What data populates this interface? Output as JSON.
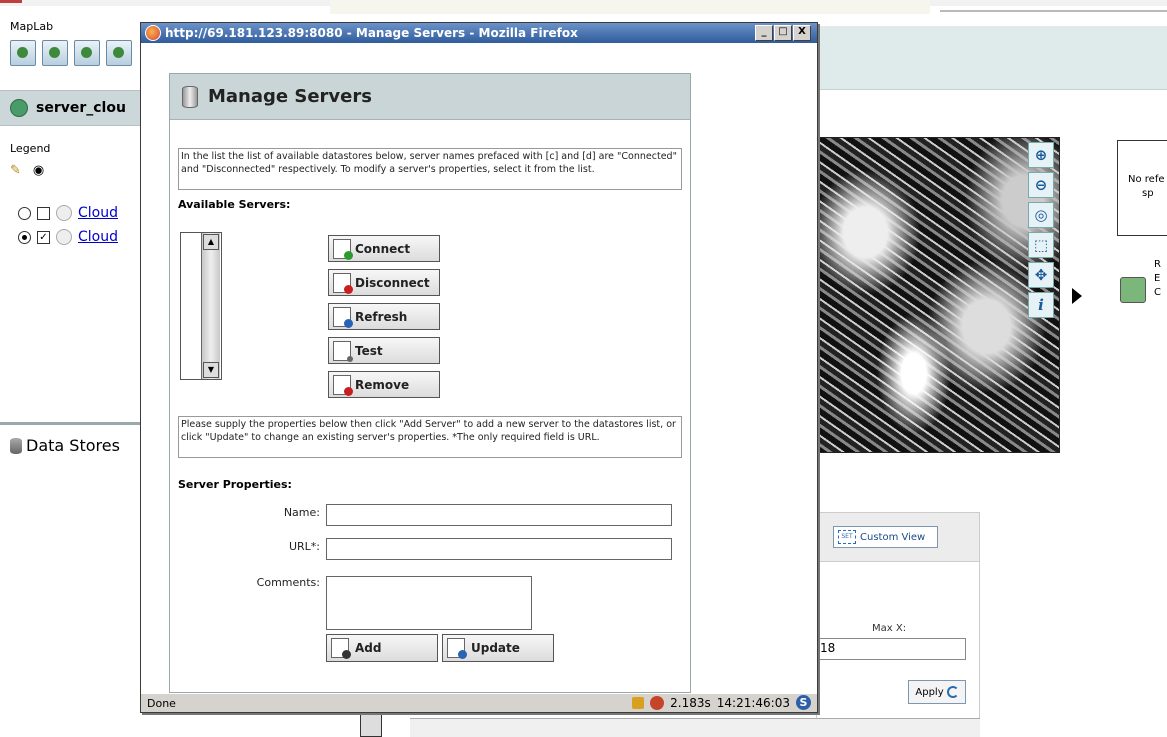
{
  "app": {
    "title": "MapLab"
  },
  "left_panel": {
    "map_name": "server_clou",
    "legend_label": "Legend",
    "legend_icons": [
      "pencil-icon",
      "eye-icon"
    ],
    "layers": [
      {
        "label": "Cloud",
        "radio_selected": false,
        "checked": false
      },
      {
        "label": "Cloud",
        "radio_selected": true,
        "checked": true
      }
    ],
    "datastores_label": "Data Stores"
  },
  "map": {
    "tools": [
      "zoom-in-icon",
      "zoom-out-icon",
      "zoom-full-icon",
      "zoom-box-icon",
      "pan-icon",
      "info-icon"
    ],
    "tool_glyphs": [
      "⊕",
      "⊖",
      "◎",
      "⬚",
      "✥",
      "i"
    ]
  },
  "reference": {
    "box_text_line1": "No refe",
    "box_text_line2": "sp",
    "side_text": [
      "R",
      "E",
      "C"
    ]
  },
  "custom_view": {
    "button_label": "Custom View",
    "icon_text": "SET"
  },
  "extent": {
    "max_x_label": "Max X:",
    "max_x_value": "18",
    "apply_label": "Apply"
  },
  "popup": {
    "window_title": "http://69.181.123.89:8080 - Manage Servers - Mozilla Firefox",
    "window_buttons": [
      "_",
      "□",
      "X"
    ],
    "panel_title": "Manage Servers",
    "list_help": "In the list the list of available datastores below, server names prefaced with [c] and [d] are \"Connected\" and \"Disconnected\" respectively. To modify a server's properties, select it from the list.",
    "available_label": "Available Servers:",
    "actions": [
      {
        "label": "Connect",
        "color": "#2e9a2e"
      },
      {
        "label": "Disconnect",
        "color": "#c82020"
      },
      {
        "label": "Refresh",
        "color": "#2a62b5"
      },
      {
        "label": "Test",
        "color": "#666666"
      },
      {
        "label": "Remove",
        "color": "#c82020"
      }
    ],
    "properties_help": "Please supply the properties below then click \"Add Server\" to add a new server to the datastores list, or click \"Update\" to change an existing server's properties. *The only required field is URL.",
    "properties_label": "Server Properties:",
    "fields": {
      "name_label": "Name:",
      "url_label": "URL*:",
      "comments_label": "Comments:",
      "name_value": "",
      "url_value": ""
    },
    "add_label": "Add",
    "update_label": "Update"
  },
  "status": {
    "left": "Done",
    "load_time": "2.183s",
    "clock": "14:21:46:03",
    "s_glyph": "S"
  }
}
